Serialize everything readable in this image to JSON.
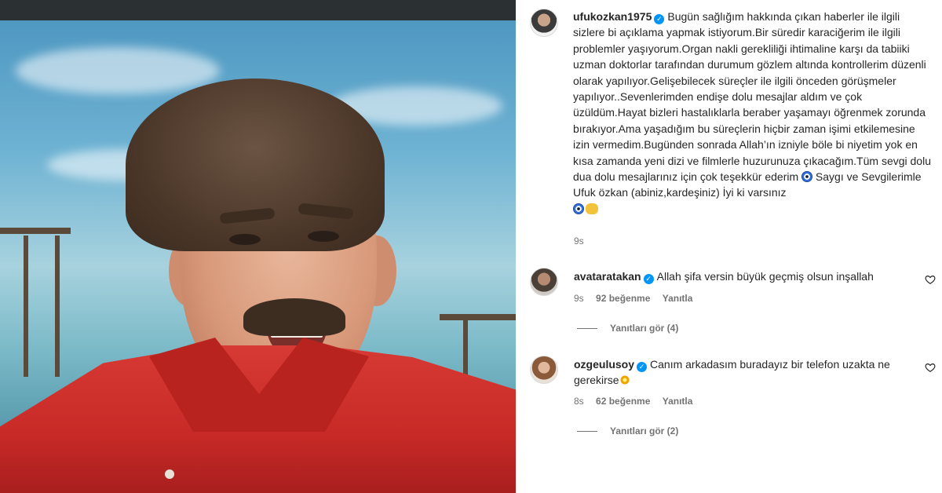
{
  "post": {
    "author": "ufukozkan1975",
    "caption": "Bugün sağlığım hakkında çıkan haberler ile ilgili sizlere bi açıklama yapmak istiyorum.Bir süredir karaciğerim ile ilgili problemler yaşıyorum.Organ nakli gerekliliği ihtimaline karşı da tabiiki uzman doktorlar tarafından durumum gözlem altında kontrollerim düzenli olarak yapılıyor.Gelişebilecek süreçler ile ilgili önceden görüşmeler yapılıyor..Sevenlerimden endişe dolu mesajlar aldım ve çok üzüldüm.Hayat bizleri hastalıklarla beraber yaşamayı öğrenmek zorunda bırakıyor.Ama yaşadığım bu süreçlerin hiçbir zaman işimi etkilemesine izin vermedim.Bugünden sonrada Allah’ın izniyle böle bi niyetim yok en kısa zamanda yeni dizi ve filmlerle huzurunuza çıkacağım.Tüm sevgi dolu dua dolu mesajlarınız için çok teşekkür ederim",
    "caption_end": "Saygı ve Sevgilerimle Ufuk özkan (abiniz,kardeşiniz) İyi ki varsınız",
    "time": "9s"
  },
  "comments": [
    {
      "username": "avataratakan",
      "text": "Allah şifa versin büyük geçmiş olsun inşallah",
      "time": "9s",
      "likes": "92 beğenme",
      "reply_label": "Yanıtla",
      "view_replies": "Yanıtları gör (4)"
    },
    {
      "username": "ozgeulusoy",
      "text": "Canım arkadasım buradayız bir telefon uzakta ne gerekirse",
      "time": "8s",
      "likes": "62 beğenme",
      "reply_label": "Yanıtla",
      "view_replies": "Yanıtları gör (2)"
    }
  ],
  "icons": {
    "verified": "verified-badge-icon",
    "evil_eye": "nazar-evil-eye-emoji",
    "hands": "heart-hands-emoji",
    "boom": "sparkle-emoji",
    "like": "heart-outline-icon"
  },
  "colors": {
    "verified": "#0095f6",
    "text": "#262626",
    "secondary": "#737373",
    "shirt": "#c82a27"
  }
}
